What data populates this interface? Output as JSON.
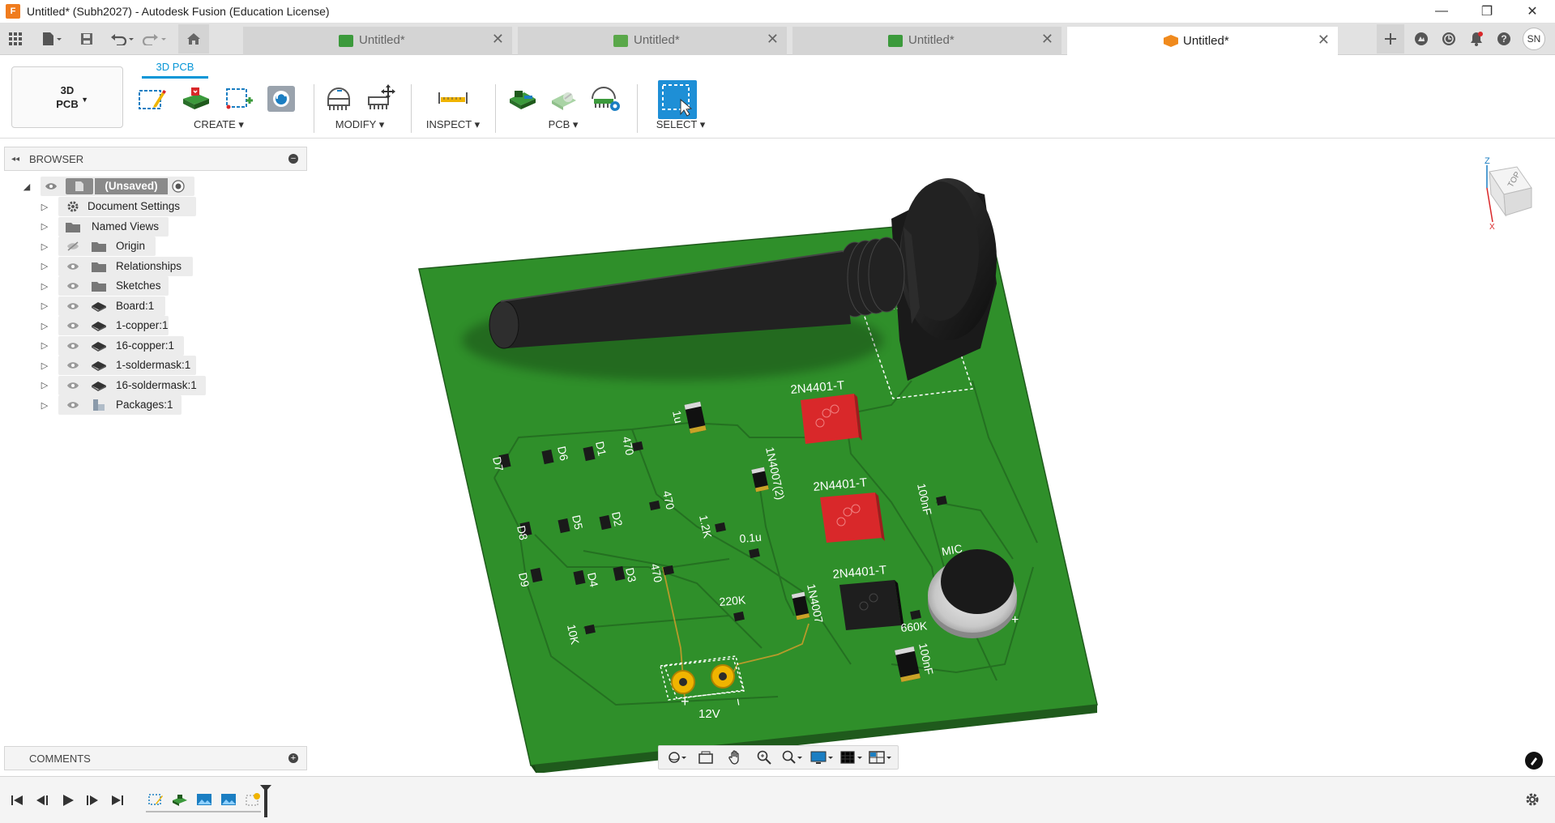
{
  "window": {
    "title": "Untitled* (Subh2027) - Autodesk Fusion (Education License)",
    "logo_letter": "F",
    "minimize": "—",
    "maximize": "❐",
    "close": "✕"
  },
  "tabs": [
    {
      "label": "Untitled*",
      "icon_color": "#3c9a3c",
      "close": "✕"
    },
    {
      "label": "Untitled*",
      "icon_color": "#3c9a3c",
      "close": "✕"
    },
    {
      "label": "Untitled*",
      "icon_color": "#3c9a3c",
      "close": "✕"
    },
    {
      "label": "Untitled*",
      "icon_color": "#f08a1d",
      "close": "✕"
    }
  ],
  "user": {
    "initials": "SN"
  },
  "toolbar": {
    "workspace_line1": "3D",
    "workspace_line2": "PCB",
    "active_tab": "3D PCB",
    "groups": {
      "create": "CREATE ▾",
      "modify": "MODIFY ▾",
      "inspect": "INSPECT ▾",
      "pcb": "PCB ▾",
      "select": "SELECT ▾"
    }
  },
  "browser": {
    "title": "BROWSER",
    "root": "(Unsaved)",
    "items": [
      {
        "label": "Document Settings",
        "icon": "gear-icon"
      },
      {
        "label": "Named Views",
        "icon": "folder-icon"
      },
      {
        "label": "Origin",
        "icon": "folder-icon",
        "hidden": true
      },
      {
        "label": "Relationships",
        "icon": "folder-icon"
      },
      {
        "label": "Sketches",
        "icon": "folder-icon"
      },
      {
        "label": "Board:1",
        "icon": "body-icon"
      },
      {
        "label": "1-copper:1",
        "icon": "body-icon"
      },
      {
        "label": "16-copper:1",
        "icon": "body-icon"
      },
      {
        "label": "1-soldermask:1",
        "icon": "body-icon"
      },
      {
        "label": "16-soldermask:1",
        "icon": "body-icon"
      },
      {
        "label": "Packages:1",
        "icon": "component-icon"
      }
    ]
  },
  "comments": {
    "title": "COMMENTS"
  },
  "viewcube": {
    "face": "TOP",
    "z": "Z",
    "x": "X"
  },
  "pcb": {
    "colors": {
      "board": "#2f8f2a",
      "board_edge": "#1f5a1c",
      "silk": "#ffffff",
      "red_part": "#d9282a",
      "pad": "#f0b400"
    },
    "labels": {
      "q1": "2N4401-T",
      "q2": "2N4401-T",
      "q3": "2N4401-T",
      "d_1n4007_2": "1N4007(2)",
      "d_1n4007": "1N4007",
      "c_1u": "1u",
      "c_100nf_a": "100nF",
      "c_100nf_b": "100nF",
      "c_01u": "0.1u",
      "r_470_a": "470",
      "r_470_b": "470",
      "r_470_c": "470",
      "r_12k": "1.2K",
      "r_220k": "220K",
      "r_660k": "660K",
      "r_10k": "10K",
      "mic": "MIC",
      "mic_plus": "+",
      "power": "12V",
      "power_plus": "+",
      "power_minus": "−",
      "d1": "D1",
      "d2": "D2",
      "d3": "D3",
      "d4": "D4",
      "d5": "D5",
      "d6": "D6",
      "d7": "D7",
      "d8": "D8",
      "d9": "D9"
    }
  }
}
